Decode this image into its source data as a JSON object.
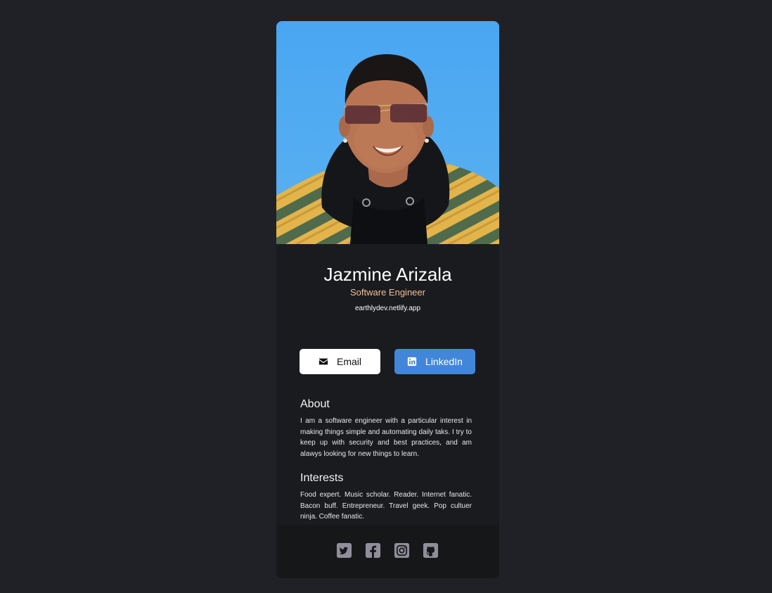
{
  "profile": {
    "name": "Jazmine Arizala",
    "title": "Software Engineer",
    "website": "earthlydev.netlify.app"
  },
  "buttons": {
    "email_label": "Email",
    "email_icon": "envelope-icon",
    "linkedin_label": "LinkedIn",
    "linkedin_icon": "linkedin-icon"
  },
  "about": {
    "heading": "About",
    "text": "I am a software engineer with a particular interest in making things simple and automating daily taks. I try to keep up with security and best practices, and am alawys looking for new things to learn."
  },
  "interests": {
    "heading": "Interests",
    "text": "Food expert. Music scholar. Reader. Internet fanatic. Bacon buff. Entrepreneur. Travel geek. Pop cultuer ninja. Coffee fanatic."
  },
  "footer": {
    "social_icons": [
      "twitter-icon",
      "facebook-icon",
      "instagram-icon",
      "github-icon"
    ]
  },
  "colors": {
    "page_background": "#202126",
    "card_background": "#1a1b1e",
    "footer_background": "#161719",
    "accent_title": "#f3bf99",
    "linkedin_blue": "#4286d9",
    "icon_gray": "#918e9b"
  }
}
